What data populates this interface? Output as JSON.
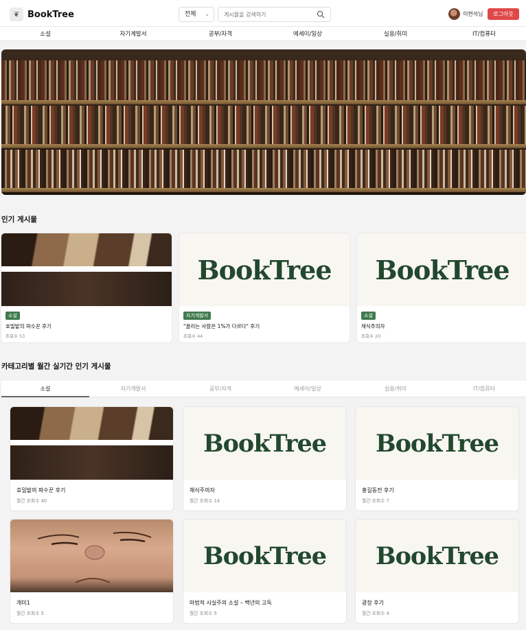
{
  "header": {
    "logo_text": "BookTree",
    "select_value": "전체",
    "search_placeholder": "게시물을 검색하기",
    "user_name": "이현석님",
    "logout_label": "로그아웃"
  },
  "nav": [
    "소설",
    "자기계발서",
    "공부/자격",
    "에세이/일상",
    "실용/취미",
    "IT/컴퓨터"
  ],
  "popular": {
    "title": "인기 게시물",
    "cards": [
      {
        "badge": "소설",
        "title": "호밀밭의 파수꾼 후기",
        "views": "조회수 53",
        "image": "photo"
      },
      {
        "badge": "자기개발서",
        "title": "\"끌리는 사람은 1%가 다르다\" 후기",
        "views": "조회수 44",
        "image": "brand",
        "brand_text": "BookTree"
      },
      {
        "badge": "소설",
        "title": "채식주의자",
        "views": "조회수 20",
        "image": "brand",
        "brand_text": "BookTree"
      }
    ]
  },
  "monthly": {
    "title": "카테고리별 월간 실기간 인기 게시물",
    "tabs": [
      "소설",
      "자기개발서",
      "공부/자격",
      "에세이/일상",
      "실용/취미",
      "IT/컴퓨터"
    ],
    "active_tab": "소설",
    "cards": [
      {
        "title": "호밀밭의 파수꾼 후기",
        "views": "월간 조회수 40",
        "image": "photo"
      },
      {
        "title": "채식주의자",
        "views": "월간 조회수 14",
        "image": "brand",
        "brand_text": "BookTree"
      },
      {
        "title": "홍길동전 후기",
        "views": "월간 조회수 7",
        "image": "brand",
        "brand_text": "BookTree"
      },
      {
        "title": "개미1",
        "views": "월간 조회수 5",
        "image": "face"
      },
      {
        "title": "마법적 사실주의 소설 – 백년의 고독",
        "views": "월간 조회수 5",
        "image": "brand",
        "brand_text": "BookTree"
      },
      {
        "title": "광장 후기",
        "views": "월간 조회수 4",
        "image": "brand",
        "brand_text": "BookTree"
      }
    ]
  },
  "colors": {
    "brand_green": "#22482f",
    "badge_green": "#3f7a4c",
    "logout_red": "#e04848"
  }
}
